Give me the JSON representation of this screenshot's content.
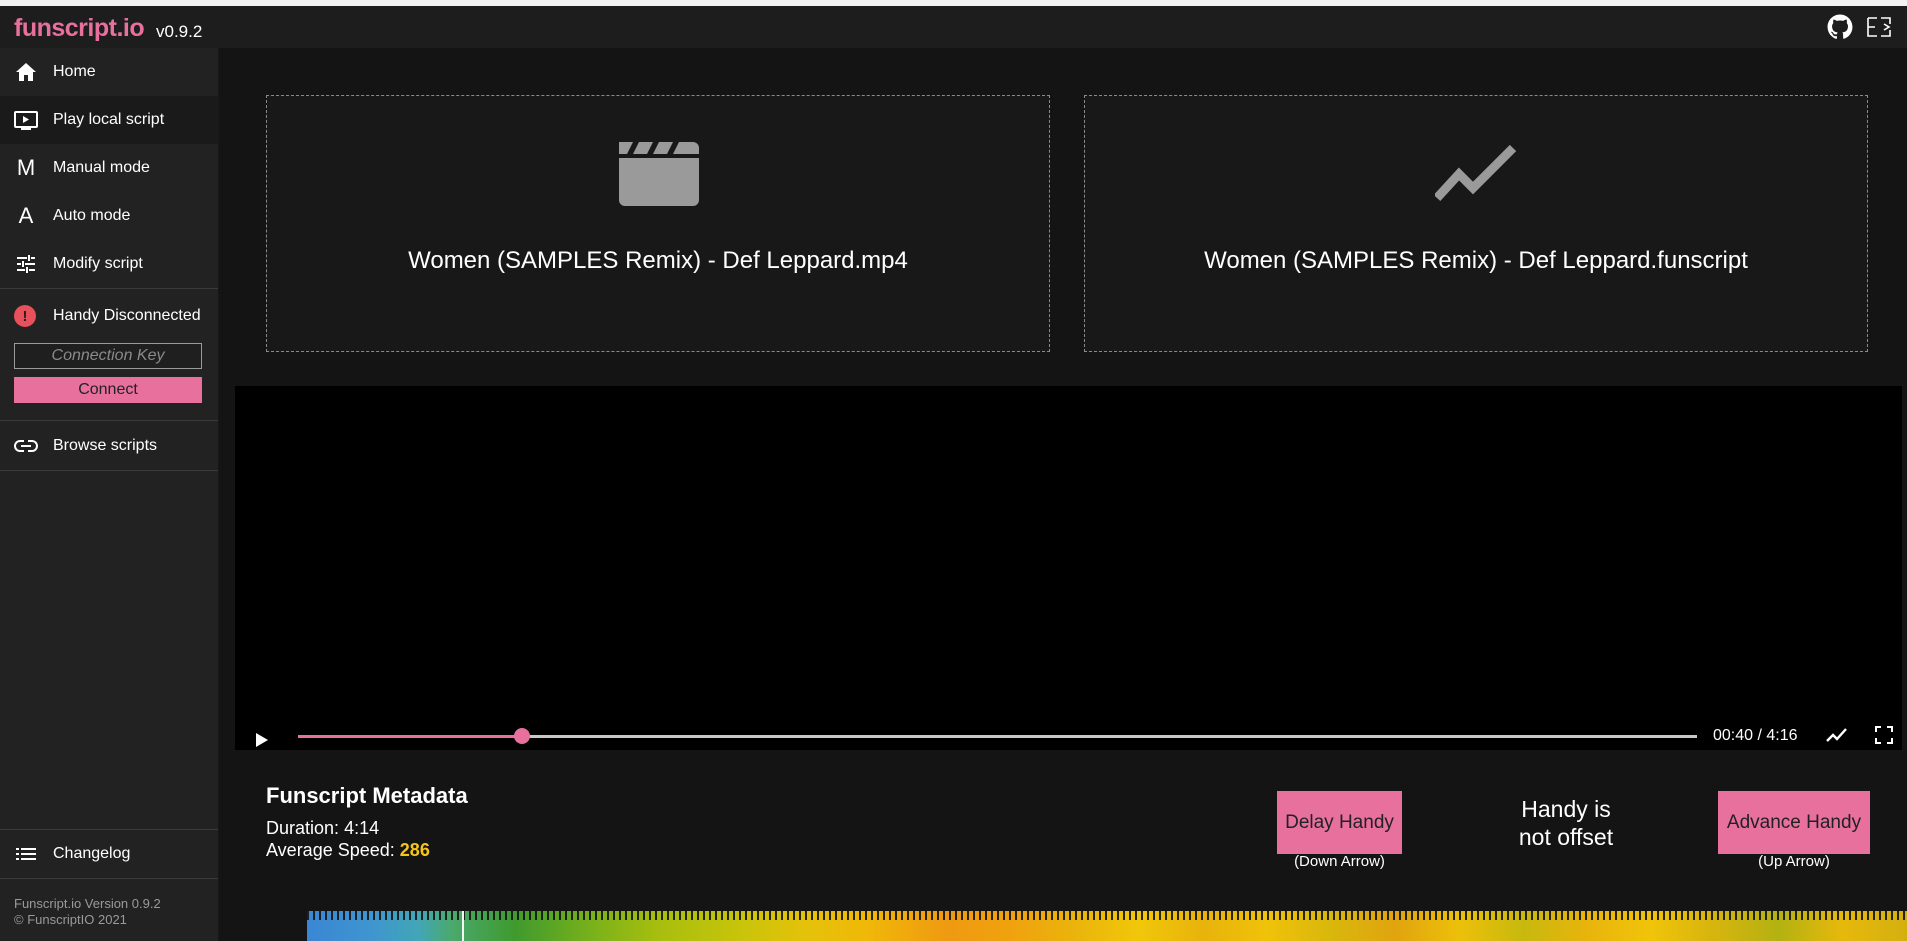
{
  "app": {
    "brand": "funscript.io",
    "version": "v0.9.2",
    "accent_color": "#e8709c"
  },
  "header": {
    "icons": [
      "github-icon",
      "exit-fullscreen-icon"
    ]
  },
  "sidebar": {
    "items": [
      {
        "label": "Home",
        "icon": "home-icon"
      },
      {
        "label": "Play local script",
        "icon": "play-local-icon"
      },
      {
        "label": "Manual mode",
        "icon": "manual-mode-icon",
        "glyph": "M"
      },
      {
        "label": "Auto mode",
        "icon": "auto-mode-icon",
        "glyph": "A"
      },
      {
        "label": "Modify script",
        "icon": "sliders-icon"
      }
    ],
    "status": {
      "label": "Handy Disconnected",
      "icon": "alert-icon",
      "glyph": "!"
    },
    "connection_key_placeholder": "Connection Key",
    "connect_label": "Connect",
    "browse_label": "Browse scripts",
    "changelog_label": "Changelog",
    "footer": {
      "version_line": "Funscript.io Version 0.9.2",
      "copyright_line": "© FunscriptIO 2021"
    }
  },
  "files": {
    "video_name": "Women (SAMPLES Remix) - Def Leppard.mp4",
    "script_name": "Women (SAMPLES Remix) - Def Leppard.funscript"
  },
  "player": {
    "time_readout": "00:40 / 4:16",
    "progress": 0.16
  },
  "metadata": {
    "title": "Funscript Metadata",
    "duration_label": "Duration:",
    "duration_value": "4:14",
    "speed_label": "Average Speed:",
    "speed_value": "286",
    "speed_color": "#f5c518"
  },
  "offset": {
    "delay_label": "Delay Handy",
    "delay_hint": "(Down Arrow)",
    "status_line1": "Handy is",
    "status_line2": "not offset",
    "advance_label": "Advance Handy",
    "advance_hint": "(Up Arrow)"
  },
  "heatmap": {
    "cursor_progress": 0.097
  }
}
